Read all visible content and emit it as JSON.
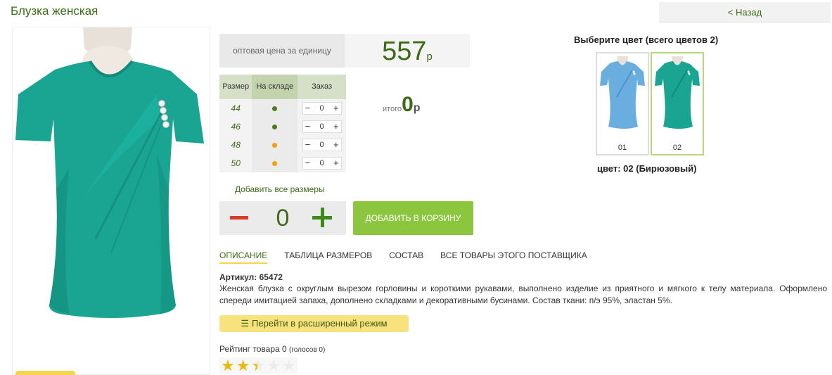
{
  "product": {
    "title": "Блузка женская",
    "back_label": "< Назад"
  },
  "price": {
    "label": "оптовая цена за единицу",
    "value": "557",
    "currency": "р"
  },
  "sizes_table": {
    "headers": {
      "size": "Размер",
      "stock": "На складе",
      "order": "Заказ"
    },
    "rows": [
      {
        "size": "44",
        "stock_color": "#4a7a1c",
        "qty": "0"
      },
      {
        "size": "46",
        "stock_color": "#4a7a1c",
        "qty": "0"
      },
      {
        "size": "48",
        "stock_color": "#f2a10c",
        "qty": "0"
      },
      {
        "size": "50",
        "stock_color": "#f2a10c",
        "qty": "0"
      }
    ],
    "minus": "−",
    "plus": "+"
  },
  "total": {
    "label": "итого",
    "value": "0",
    "currency": "р"
  },
  "add_all_sizes": "Добавить все размеры",
  "quantity": {
    "value": "0"
  },
  "add_to_cart": "ДОБАВИТЬ В КОРЗИНУ",
  "tabs": [
    {
      "label": "ОПИСАНИЕ",
      "active": true
    },
    {
      "label": "ТАБЛИЦА РАЗМЕРОВ"
    },
    {
      "label": "СОСТАВ"
    },
    {
      "label": "ВСЕ ТОВАРЫ ЭТОГО ПОСТАВЩИКА"
    }
  ],
  "article": "Артикул: 65472",
  "description": "Женская блузка с округлым вырезом горловины и короткими рукавами, выполнено изделие из приятного и мягкого к телу материала. Оформлено спереди имитацией запаха, дополнено складками и декоративными бусинами. Состав ткани: п/э 95%, эластан 5%.",
  "advanced_mode": "Перейти в расширенный режим",
  "rating": {
    "label": "Рейтинг товара 0",
    "votes": "(голосов 0)",
    "stars_shown": 2.5,
    "stars_max": 5
  },
  "colors": {
    "header": "Выберите цвет (всего цветов 2)",
    "options": [
      {
        "code": "01",
        "color": "#6aaee0"
      },
      {
        "code": "02",
        "color": "#1aa593"
      }
    ],
    "selected_label": "цвет: 02 (Бирюзовый)"
  },
  "accent": {
    "green": "#3d6b16",
    "button": "#8cc63f",
    "shirt": "#1aa593"
  }
}
